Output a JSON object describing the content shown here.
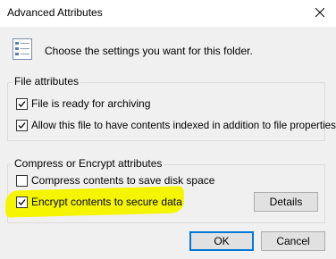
{
  "window": {
    "title": "Advanced Attributes",
    "close_icon": "close-icon"
  },
  "intro": {
    "icon": "settings-list-icon",
    "text": "Choose the settings you want for this folder."
  },
  "file_attributes": {
    "legend": "File attributes",
    "archive": {
      "label": "File is ready for archiving",
      "checked": true
    },
    "indexed": {
      "label": "Allow this file to have contents indexed in addition to file properties",
      "checked": true
    }
  },
  "compress_encrypt": {
    "legend": "Compress or Encrypt attributes",
    "compress": {
      "label": "Compress contents to save disk space",
      "checked": false
    },
    "encrypt": {
      "label": "Encrypt contents to secure data",
      "checked": true
    },
    "details_label": "Details"
  },
  "buttons": {
    "ok_label": "OK",
    "cancel_label": "Cancel"
  },
  "colors": {
    "highlight": "#f5f500",
    "default_button_border": "#0078d7"
  }
}
